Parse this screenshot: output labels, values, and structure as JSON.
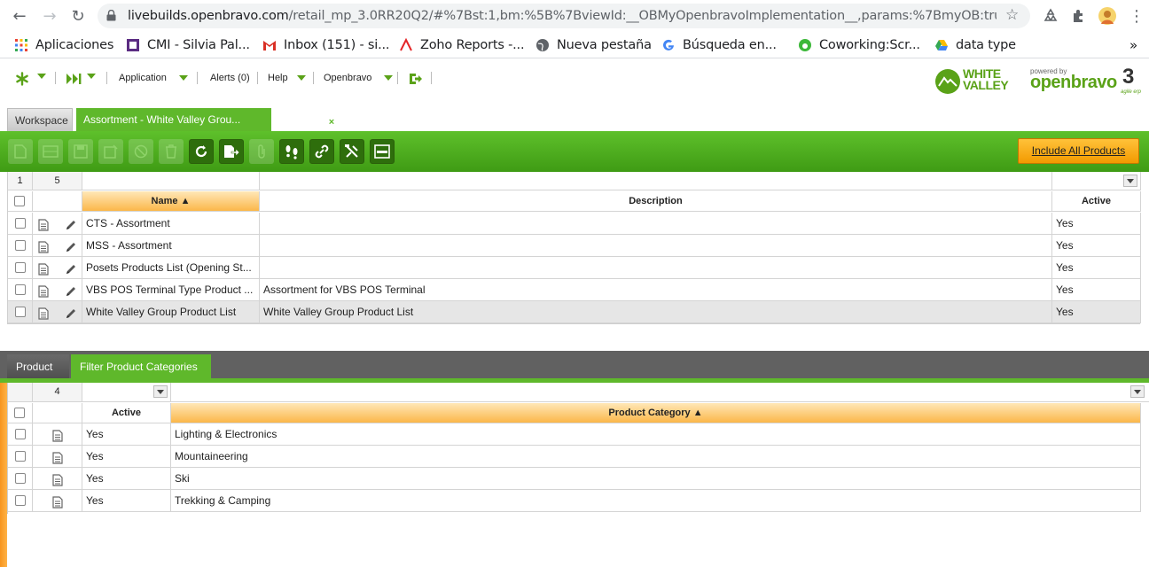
{
  "browser": {
    "url_host": "livebuilds.openbravo.com",
    "url_rest": "/retail_mp_3.0RR20Q2/#%7Bst:1,bm:%5B%7BviewId:__OBMyOpenbravoImplementation__,params:%7BmyOB:true,canClose:fa...",
    "bookmarks": [
      {
        "label": "Aplicaciones",
        "icon": "apps-grid-icon"
      },
      {
        "label": "CMI - Silvia Pal...",
        "icon": "cmi-icon"
      },
      {
        "label": "Inbox (151) - si...",
        "icon": "gmail-icon"
      },
      {
        "label": "Zoho Reports -...",
        "icon": "zoho-icon"
      },
      {
        "label": "Nueva pestaña",
        "icon": "globe-icon"
      },
      {
        "label": "Búsqueda en...",
        "icon": "google-icon"
      },
      {
        "label": "Coworking:Scr...",
        "icon": "coworking-icon"
      },
      {
        "label": "data type",
        "icon": "drive-icon"
      }
    ],
    "more": "»"
  },
  "appbar": {
    "menus": [
      "Application",
      "Alerts (0)",
      "Help",
      "Openbravo"
    ],
    "logo_wv_line1": "WHITE",
    "logo_wv_line2": "VALLEY",
    "powered_by": "powered by",
    "ob_brand": "openbravo",
    "ob_version": "3",
    "ob_tagline": "agile erp"
  },
  "tabs": {
    "workspace": "Workspace",
    "active": "Assortment - White Valley Grou...",
    "close": "×"
  },
  "toolbar": {
    "include_all": "Include All Products"
  },
  "upper_grid": {
    "filter_num": "1",
    "count": "5",
    "columns": [
      "Name ▲",
      "Description",
      "Active"
    ],
    "rows": [
      {
        "name": "CTS - Assortment",
        "description": "",
        "active": "Yes"
      },
      {
        "name": "MSS - Assortment",
        "description": "",
        "active": "Yes"
      },
      {
        "name": "Posets Products List (Opening St...",
        "description": "",
        "active": "Yes"
      },
      {
        "name": "VBS POS Terminal Type Product ...",
        "description": "Assortment for VBS POS Terminal",
        "active": "Yes"
      },
      {
        "name": "White Valley Group Product List",
        "description": "White Valley Group Product List",
        "active": "Yes"
      }
    ]
  },
  "lower_tabs": {
    "product": "Product",
    "filter": "Filter Product Categories"
  },
  "lower_grid": {
    "count": "4",
    "columns": [
      "Active",
      "Product Category ▲"
    ],
    "rows": [
      {
        "active": "Yes",
        "category": "Lighting & Electronics"
      },
      {
        "active": "Yes",
        "category": "Mountaineering"
      },
      {
        "active": "Yes",
        "category": "Ski"
      },
      {
        "active": "Yes",
        "category": "Trekking & Camping"
      }
    ]
  }
}
